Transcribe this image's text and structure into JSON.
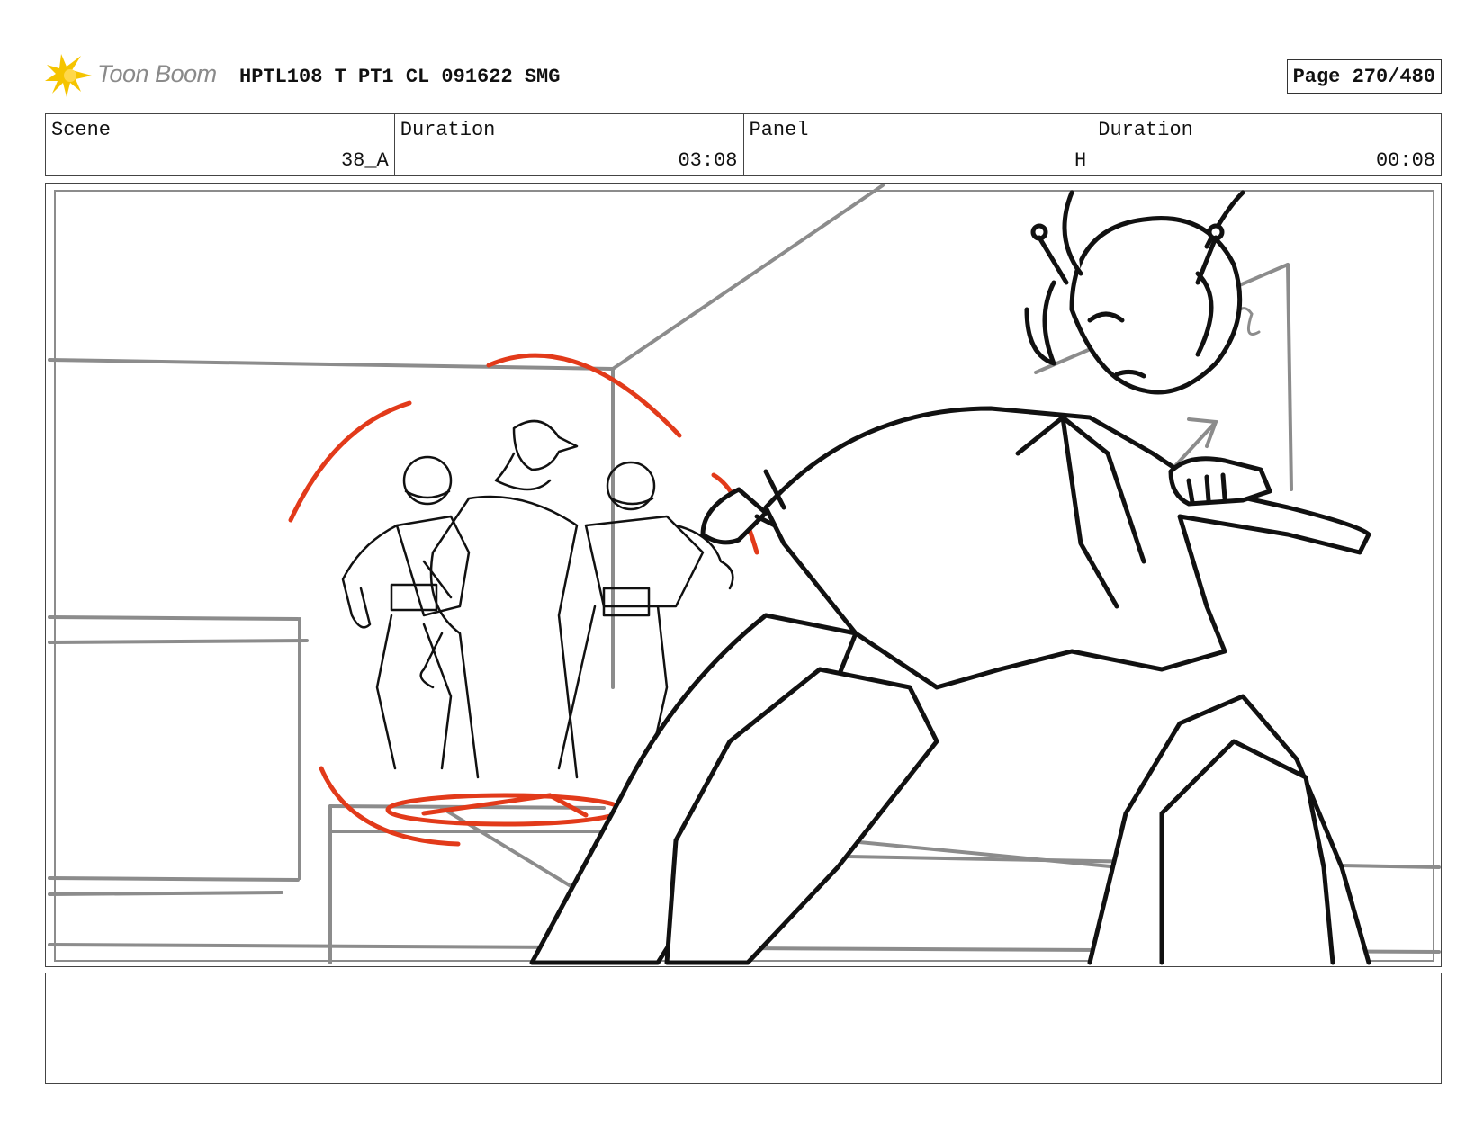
{
  "header": {
    "logo_text": "Toon Boom",
    "title": "HPTL108 T PT1 CL 091622 SMG",
    "page_label": "Page 270/480"
  },
  "info": {
    "scene_label": "Scene",
    "scene_value": "38_A",
    "scene_duration_label": "Duration",
    "scene_duration_value": "03:08",
    "panel_label": "Panel",
    "panel_value": "H",
    "panel_duration_label": "Duration",
    "panel_duration_value": "00:08"
  },
  "colors": {
    "logo_yellow": "#f5c400",
    "sketch_black": "#111111",
    "sketch_gray": "#8c8c8c",
    "sketch_red": "#e23a1a"
  },
  "caption": ""
}
